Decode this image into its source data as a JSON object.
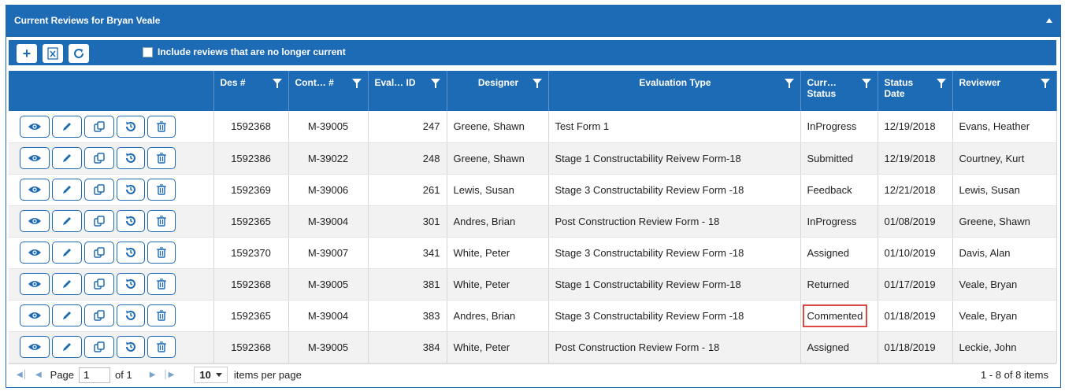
{
  "panel": {
    "title": "Current Reviews for Bryan Veale"
  },
  "toolbar": {
    "add_icon": "plus-icon",
    "export_icon": "excel-export-icon",
    "refresh_icon": "refresh-icon",
    "include_label": "Include reviews that are no longer current",
    "include_checked": false
  },
  "columns": {
    "des": "Des #",
    "contract": "Cont… #",
    "eval_id": "Eval… ID",
    "designer": "Designer",
    "evaluation_type": "Evaluation Type",
    "current_status": "Curr… Status",
    "status_date": "Status Date",
    "reviewer": "Reviewer"
  },
  "rows": [
    {
      "des": "1592368",
      "contract": "M-39005",
      "eval_id": "247",
      "designer": "Greene, Shawn",
      "evaluation_type": "Test Form 1",
      "status": "InProgress",
      "date": "12/19/2018",
      "reviewer": "Evans, Heather"
    },
    {
      "des": "1592386",
      "contract": "M-39022",
      "eval_id": "248",
      "designer": "Greene, Shawn",
      "evaluation_type": "Stage 1 Constructability Reivew Form-18",
      "status": "Submitted",
      "date": "12/19/2018",
      "reviewer": "Courtney, Kurt"
    },
    {
      "des": "1592369",
      "contract": "M-39006",
      "eval_id": "261",
      "designer": "Lewis, Susan",
      "evaluation_type": "Stage 3 Constructability Review Form -18",
      "status": "Feedback",
      "date": "12/21/2018",
      "reviewer": "Lewis, Susan"
    },
    {
      "des": "1592365",
      "contract": "M-39004",
      "eval_id": "301",
      "designer": "Andres, Brian",
      "evaluation_type": "Post Construction Review Form - 18",
      "status": "InProgress",
      "date": "01/08/2019",
      "reviewer": "Greene, Shawn"
    },
    {
      "des": "1592370",
      "contract": "M-39007",
      "eval_id": "341",
      "designer": "White, Peter",
      "evaluation_type": "Stage 3 Constructability Review Form -18",
      "status": "Assigned",
      "date": "01/10/2019",
      "reviewer": "Davis, Alan"
    },
    {
      "des": "1592368",
      "contract": "M-39005",
      "eval_id": "381",
      "designer": "White, Peter",
      "evaluation_type": "Stage 1 Constructability Review Form-18",
      "status": "Returned",
      "date": "01/17/2019",
      "reviewer": "Veale, Bryan"
    },
    {
      "des": "1592365",
      "contract": "M-39004",
      "eval_id": "383",
      "designer": "Andres, Brian",
      "evaluation_type": "Stage 3 Constructability Review Form -18",
      "status": "Commented",
      "date": "01/18/2019",
      "reviewer": "Veale, Bryan"
    },
    {
      "des": "1592368",
      "contract": "M-39005",
      "eval_id": "384",
      "designer": "White, Peter",
      "evaluation_type": "Post Construction Review Form - 18",
      "status": "Assigned",
      "date": "01/18/2019",
      "reviewer": "Leckie, John"
    }
  ],
  "row_actions": [
    "view-icon",
    "edit-icon",
    "copy-icon",
    "history-icon",
    "delete-icon"
  ],
  "highlight": {
    "row": 6,
    "column": "status",
    "color": "#e04848"
  },
  "pager": {
    "page_label": "Page",
    "page_value": "1",
    "of_label": "of 1",
    "page_size": "10",
    "items_label": "items per page",
    "range": "1 - 8 of 8 items"
  },
  "colors": {
    "accent": "#1e6bb5",
    "alt_row": "#f2f2f2"
  }
}
